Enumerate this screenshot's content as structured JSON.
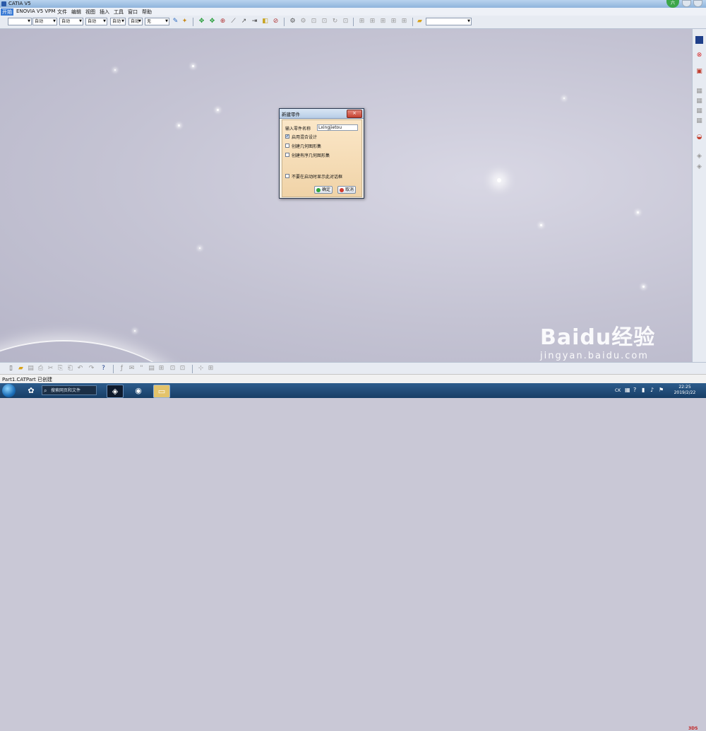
{
  "window": {
    "title": "CATIA V5",
    "user_initial": "六"
  },
  "menu": [
    "开始",
    "ENOVIA V5 VPM",
    "文件",
    "编辑",
    "视图",
    "插入",
    "工具",
    "窗口",
    "帮助"
  ],
  "toolbar": {
    "combo_1": "",
    "combo_2": "自动",
    "combo_3": "自动",
    "combo_4": "自动",
    "combo_5": "自动",
    "combo_6": "自动",
    "combo_7": "无",
    "right_combo": ""
  },
  "dialog": {
    "title": "新建零件",
    "close_icon": "×",
    "name_label": "输入零件名称",
    "name_value": "Lxingjietou",
    "option_1": "启用混合设计",
    "option_1_checked": true,
    "option_2": "创建几何图形集",
    "option_2_checked": false,
    "option_3": "创建有序几何图形集",
    "option_3_checked": false,
    "option_4": "不要在启动时显示此对话框",
    "option_4_checked": false,
    "ok_label": "确定",
    "cancel_label": "取消"
  },
  "status": {
    "text": "Part1.CATPart 已创建"
  },
  "taskbar": {
    "search_placeholder": "搜索网页和文件",
    "time": "22:25",
    "date": "2019/2/22",
    "lang": "CK"
  },
  "watermark": {
    "brand": "Baidu经验",
    "url": "jingyan.baidu.com"
  },
  "colors": {
    "accent": "#3a7bd5",
    "close_red": "#c4402f",
    "dialog_bg": "#f0d3a7",
    "taskbar": "#183e66"
  }
}
